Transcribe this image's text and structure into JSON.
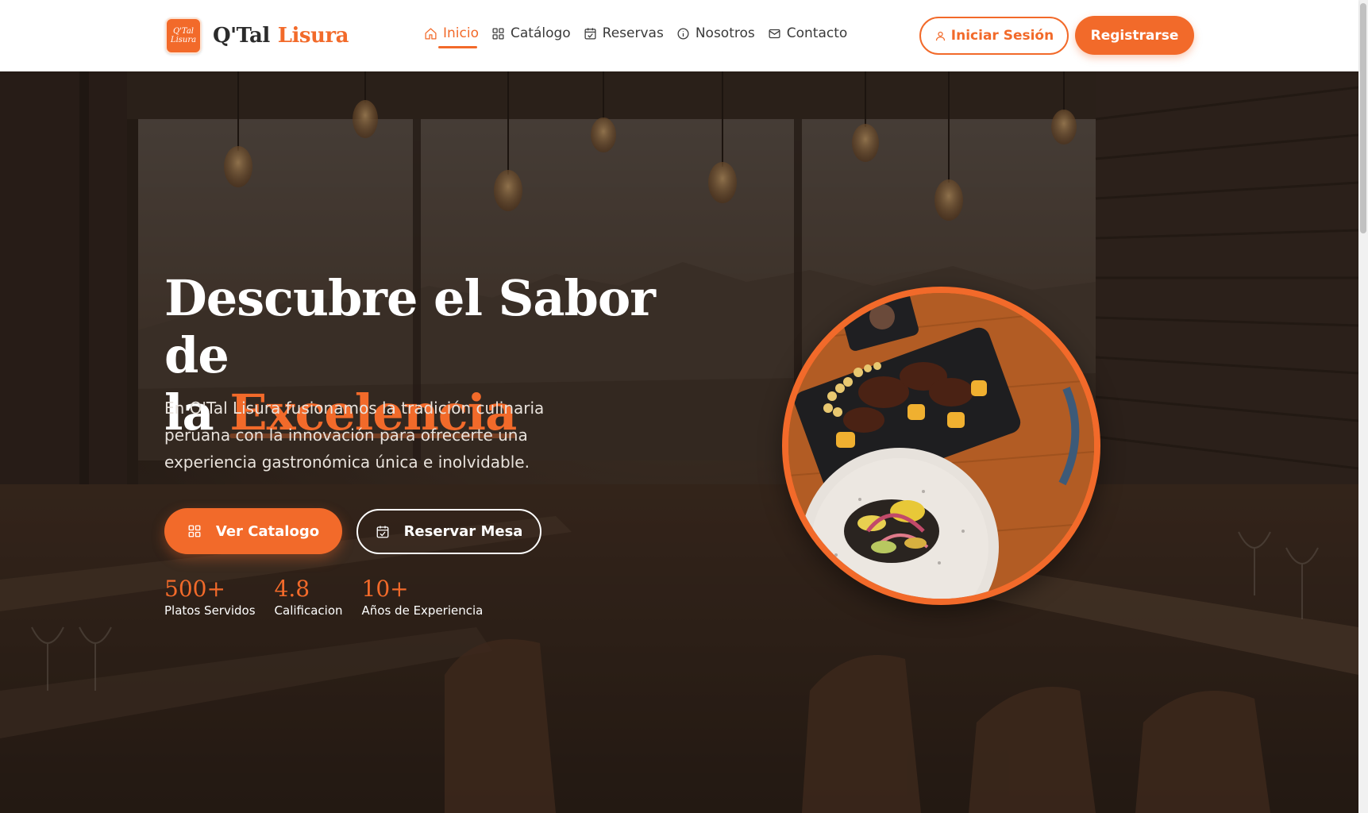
{
  "brand": {
    "logo_text": "Q'Tal Lisura",
    "name_first": "Q'Tal",
    "name_second": "Lisura"
  },
  "nav": {
    "items": [
      {
        "label": "Inicio",
        "icon": "home-icon",
        "active": true
      },
      {
        "label": "Catálogo",
        "icon": "grid-icon",
        "active": false
      },
      {
        "label": "Reservas",
        "icon": "calendar-icon",
        "active": false
      },
      {
        "label": "Nosotros",
        "icon": "info-icon",
        "active": false
      },
      {
        "label": "Contacto",
        "icon": "mail-icon",
        "active": false
      }
    ]
  },
  "auth": {
    "login_label": "Iniciar Sesión",
    "register_label": "Registrarse"
  },
  "hero": {
    "title_line1": "Descubre el Sabor de",
    "title_line2_prefix": "la ",
    "title_accent": "Excelencia",
    "description": "En Q'Tal Lisura fusionamos la tradición culinaria peruana con la innovación para ofrecerte una experiencia gastronómica única e inolvidable.",
    "cta_catalog": "Ver Catalogo",
    "cta_reserve": "Reservar Mesa"
  },
  "stats": [
    {
      "value": "500+",
      "label": "Platos Servidos"
    },
    {
      "value": "4.8",
      "label": "Calificacion"
    },
    {
      "value": "10+",
      "label": "Años de Experiencia"
    }
  ],
  "colors": {
    "accent": "#f26a2a",
    "header_bg": "#ffffff",
    "nav_text": "#3a3a3a"
  }
}
